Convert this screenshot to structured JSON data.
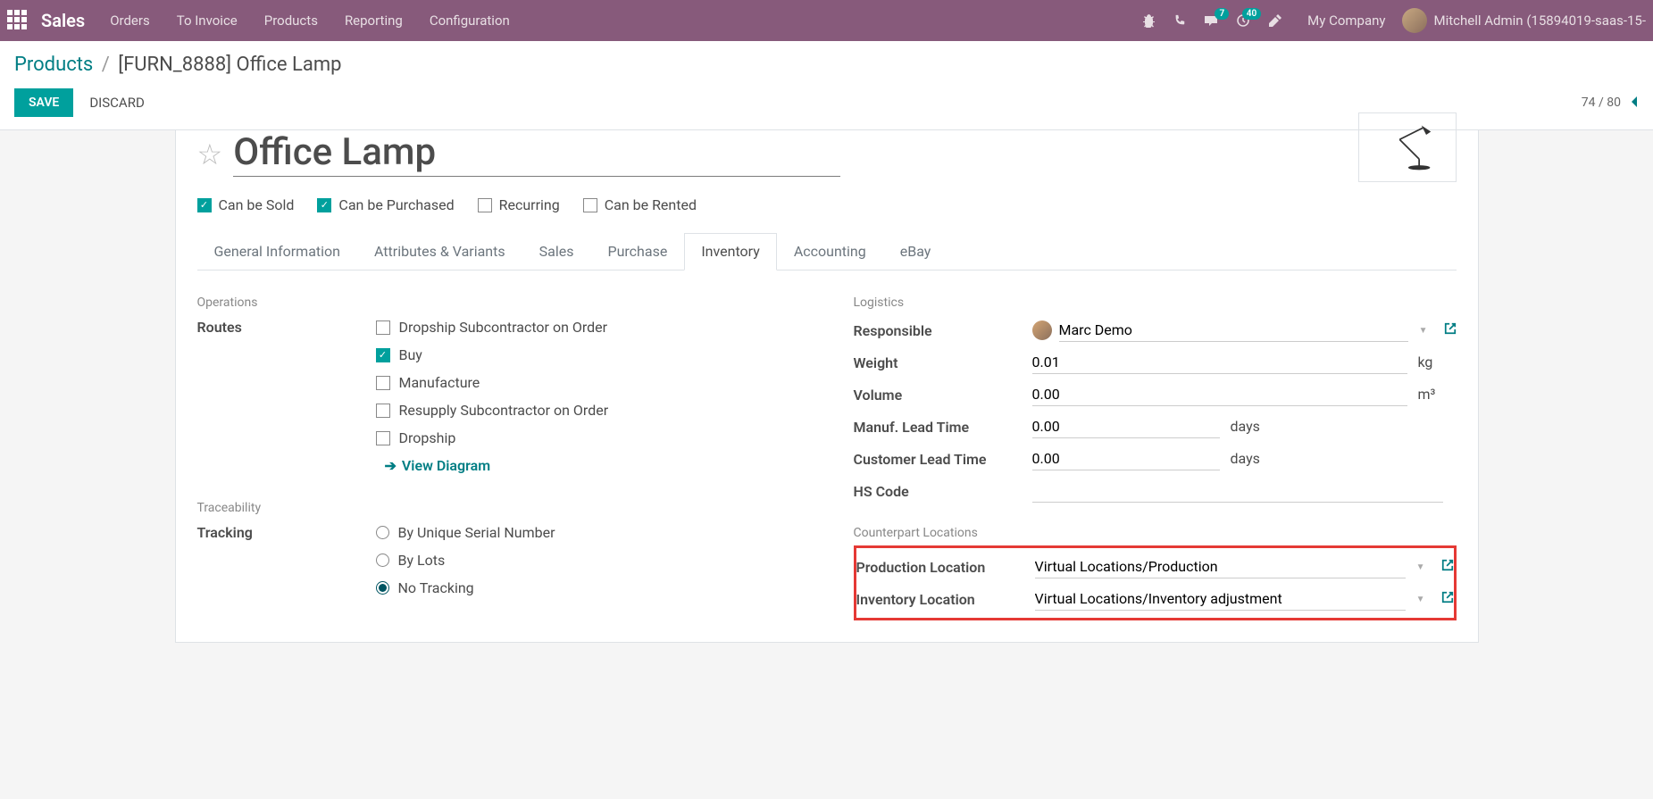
{
  "nav": {
    "brand": "Sales",
    "items": [
      "Orders",
      "To Invoice",
      "Products",
      "Reporting",
      "Configuration"
    ],
    "messages_badge": "7",
    "activities_badge": "40",
    "company": "My Company",
    "user": "Mitchell Admin (15894019-saas-15-"
  },
  "breadcrumb": {
    "parent": "Products",
    "current": "[FURN_8888] Office Lamp"
  },
  "buttons": {
    "save": "SAVE",
    "discard": "DISCARD"
  },
  "pager": {
    "text": "74 / 80"
  },
  "product": {
    "name": "Office Lamp",
    "checkboxes": {
      "sold": {
        "label": "Can be Sold",
        "checked": true
      },
      "purchased": {
        "label": "Can be Purchased",
        "checked": true
      },
      "recurring": {
        "label": "Recurring",
        "checked": false
      },
      "rented": {
        "label": "Can be Rented",
        "checked": false
      }
    }
  },
  "tabs": [
    "General Information",
    "Attributes & Variants",
    "Sales",
    "Purchase",
    "Inventory",
    "Accounting",
    "eBay"
  ],
  "operations": {
    "title": "Operations",
    "routes_label": "Routes",
    "routes": [
      {
        "label": "Dropship Subcontractor on Order",
        "checked": false
      },
      {
        "label": "Buy",
        "checked": true
      },
      {
        "label": "Manufacture",
        "checked": false
      },
      {
        "label": "Resupply Subcontractor on Order",
        "checked": false
      },
      {
        "label": "Dropship",
        "checked": false
      }
    ],
    "view_diagram": "View Diagram"
  },
  "traceability": {
    "title": "Traceability",
    "tracking_label": "Tracking",
    "options": [
      {
        "label": "By Unique Serial Number",
        "on": false
      },
      {
        "label": "By Lots",
        "on": false
      },
      {
        "label": "No Tracking",
        "on": true
      }
    ]
  },
  "logistics": {
    "title": "Logistics",
    "responsible_label": "Responsible",
    "responsible_value": "Marc Demo",
    "weight_label": "Weight",
    "weight_value": "0.01",
    "weight_unit": "kg",
    "volume_label": "Volume",
    "volume_value": "0.00",
    "volume_unit": "m³",
    "manuf_label": "Manuf. Lead Time",
    "manuf_value": "0.00",
    "manuf_unit": "days",
    "cust_label": "Customer Lead Time",
    "cust_value": "0.00",
    "cust_unit": "days",
    "hscode_label": "HS Code",
    "hscode_value": ""
  },
  "counterpart": {
    "title": "Counterpart Locations",
    "prod_label": "Production Location",
    "prod_value": "Virtual Locations/Production",
    "inv_label": "Inventory Location",
    "inv_value": "Virtual Locations/Inventory adjustment"
  }
}
